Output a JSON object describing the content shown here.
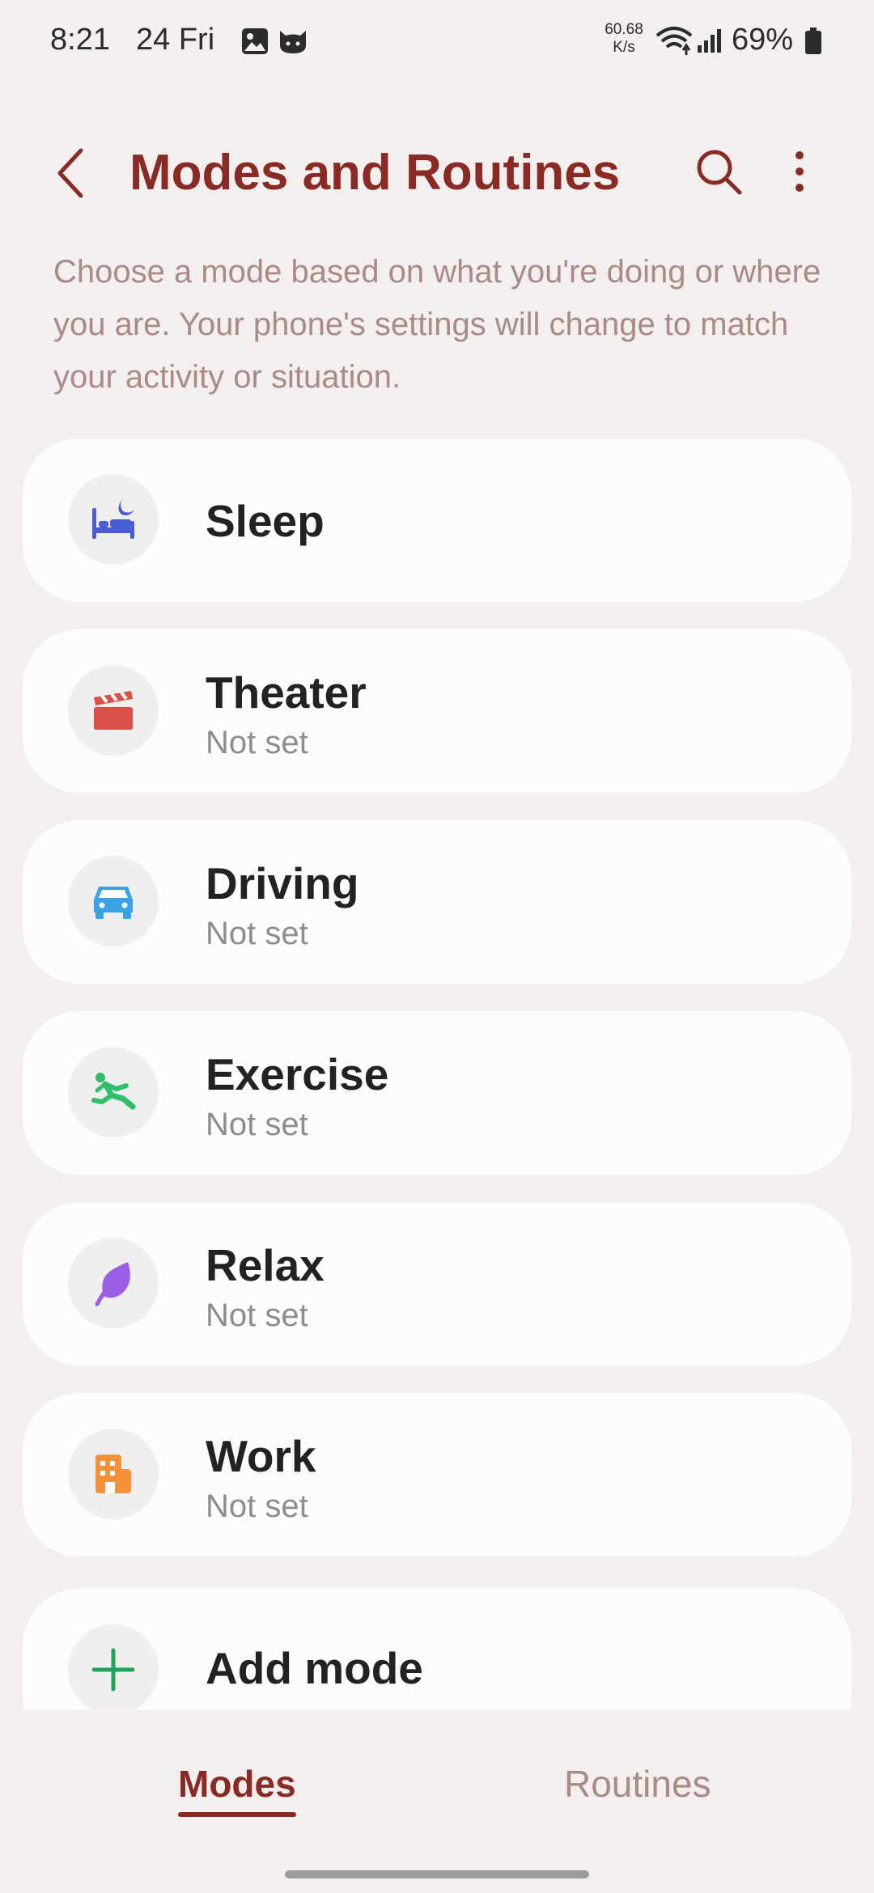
{
  "status_bar": {
    "time": "8:21",
    "date": "24 Fri",
    "speed_value": "60.68",
    "speed_unit": "K/s",
    "battery": "69%"
  },
  "header": {
    "title": "Modes and Routines"
  },
  "description": "Choose a mode based on what you're doing or where you are. Your phone's settings will change to match your activity or situation.",
  "modes": [
    {
      "name": "Sleep",
      "status": "",
      "icon": "bed-moon-icon",
      "color": "#4a5cd6"
    },
    {
      "name": "Theater",
      "status": "Not set",
      "icon": "clapperboard-icon",
      "color": "#d9524a"
    },
    {
      "name": "Driving",
      "status": "Not set",
      "icon": "car-icon",
      "color": "#3aa3e6"
    },
    {
      "name": "Exercise",
      "status": "Not set",
      "icon": "running-person-icon",
      "color": "#2fbf6b"
    },
    {
      "name": "Relax",
      "status": "Not set",
      "icon": "leaf-icon",
      "color": "#9b5de5"
    },
    {
      "name": "Work",
      "status": "Not set",
      "icon": "building-icon",
      "color": "#f4923a"
    }
  ],
  "add_mode": {
    "label": "Add mode",
    "icon": "plus-icon",
    "color": "#1fa35a"
  },
  "tabs": [
    {
      "label": "Modes",
      "active": true
    },
    {
      "label": "Routines",
      "active": false
    }
  ],
  "colors": {
    "accent": "#8a2a24",
    "background": "#f3efee",
    "card": "#fdfcfc"
  }
}
